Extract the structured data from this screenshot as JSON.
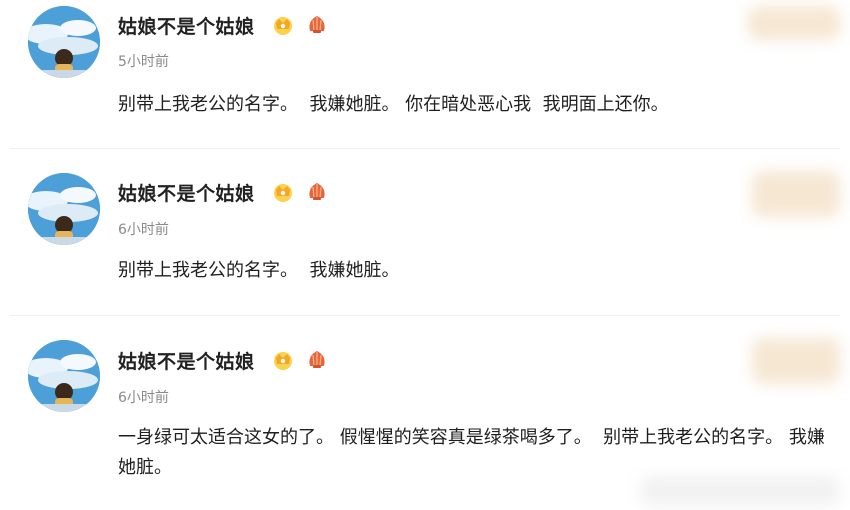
{
  "comments": [
    {
      "username": "姑娘不是个姑娘",
      "time": "5小时前",
      "text": "别带上我老公的名字。  我嫌她脏。 你在暗处恶心我  我明面上还你。",
      "badges": [
        "crown-badge-icon",
        "shell-badge-icon"
      ],
      "avatar": "sky-avatar-icon"
    },
    {
      "username": "姑娘不是个姑娘",
      "time": "6小时前",
      "text": "别带上我老公的名字。  我嫌她脏。",
      "badges": [
        "crown-badge-icon",
        "shell-badge-icon"
      ],
      "avatar": "sky-avatar-icon"
    },
    {
      "username": "姑娘不是个姑娘",
      "time": "6小时前",
      "text": "一身绿可太适合这女的了。 假惺惺的笑容真是绿茶喝多了。  别带上我老公的名字。 我嫌她脏。",
      "badges": [
        "crown-badge-icon",
        "shell-badge-icon"
      ],
      "avatar": "sky-avatar-icon"
    }
  ],
  "colors": {
    "username": "#222222",
    "time": "#8a8a8a",
    "text": "#1f1f1f",
    "divider": "#eeeeee",
    "crown_badge": "#f5a623",
    "shell_badge": "#e8663d",
    "blur_patch": "#f6e7d3"
  }
}
